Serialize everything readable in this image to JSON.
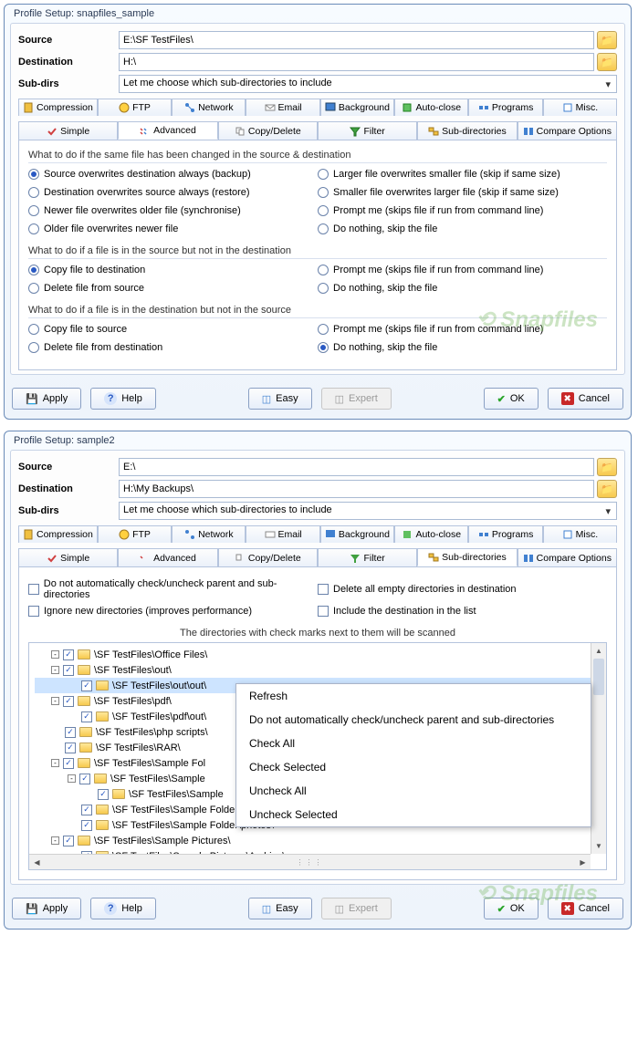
{
  "win1": {
    "title": "Profile Setup: snapfiles_sample",
    "labels": {
      "source": "Source",
      "destination": "Destination",
      "subdirs": "Sub-dirs"
    },
    "source": "E:\\SF TestFiles\\",
    "destination": "H:\\",
    "subdirs_opt": "Let me choose which sub-directories to include",
    "tabs1": [
      "Compression",
      "FTP",
      "Network",
      "Email",
      "Background",
      "Auto-close",
      "Programs",
      "Misc."
    ],
    "tabs2": [
      "Simple",
      "Advanced",
      "Copy/Delete",
      "Filter",
      "Sub-directories",
      "Compare Options"
    ],
    "sec1": "What to do if the same file has been changed in the source & destination",
    "sec1_left": [
      {
        "label": "Source overwrites destination always (backup)",
        "sel": true
      },
      {
        "label": "Destination overwrites source always (restore)",
        "sel": false
      },
      {
        "label": "Newer file overwrites older file (synchronise)",
        "sel": false
      },
      {
        "label": "Older file overwrites newer file",
        "sel": false
      }
    ],
    "sec1_right": [
      {
        "label": "Larger file overwrites smaller file (skip if same size)",
        "sel": false
      },
      {
        "label": "Smaller file overwrites larger file (skip if same size)",
        "sel": false
      },
      {
        "label": "Prompt me (skips file if run from command line)",
        "sel": false
      },
      {
        "label": "Do nothing, skip the file",
        "sel": false
      }
    ],
    "sec2": "What to do if a file is in the source but not in the destination",
    "sec2_left": [
      {
        "label": "Copy file to destination",
        "sel": true
      },
      {
        "label": "Delete file from source",
        "sel": false
      }
    ],
    "sec2_right": [
      {
        "label": "Prompt me  (skips file if run from command line)",
        "sel": false
      },
      {
        "label": "Do nothing, skip the file",
        "sel": false
      }
    ],
    "sec3": "What to do if a file is in the destination but not in the source",
    "sec3_left": [
      {
        "label": "Copy file to source",
        "sel": false
      },
      {
        "label": "Delete file from destination",
        "sel": false
      }
    ],
    "sec3_right": [
      {
        "label": "Prompt me  (skips file if run from command line)",
        "sel": false
      },
      {
        "label": "Do nothing, skip the file",
        "sel": true
      }
    ]
  },
  "win2": {
    "title": "Profile Setup: sample2",
    "source": "E:\\",
    "destination": "H:\\My Backups\\",
    "subdirs_opt": "Let me choose which sub-directories to include",
    "checks": [
      {
        "label": "Do not automatically check/uncheck parent and sub-directories",
        "checked": false
      },
      {
        "label": "Delete all empty directories in destination",
        "checked": false
      },
      {
        "label": "Ignore new directories (improves performance)",
        "checked": false
      },
      {
        "label": "Include the destination in the list",
        "checked": false
      }
    ],
    "scan_info": "The directories with check marks next to them will be scanned",
    "tree": [
      {
        "indent": 0,
        "toggle": "-",
        "checked": true,
        "label": "\\SF TestFiles\\Office Files\\"
      },
      {
        "indent": 0,
        "toggle": "-",
        "checked": true,
        "label": "\\SF TestFiles\\out\\"
      },
      {
        "indent": 1,
        "toggle": "",
        "checked": true,
        "label": "\\SF TestFiles\\out\\out\\",
        "sel": true
      },
      {
        "indent": 0,
        "toggle": "-",
        "checked": true,
        "label": "\\SF TestFiles\\pdf\\"
      },
      {
        "indent": 1,
        "toggle": "",
        "checked": true,
        "label": "\\SF TestFiles\\pdf\\out\\"
      },
      {
        "indent": 0,
        "toggle": "",
        "checked": true,
        "label": "\\SF TestFiles\\php scripts\\"
      },
      {
        "indent": 0,
        "toggle": "",
        "checked": true,
        "label": "\\SF TestFiles\\RAR\\"
      },
      {
        "indent": 0,
        "toggle": "-",
        "checked": true,
        "label": "\\SF TestFiles\\Sample Fol"
      },
      {
        "indent": 1,
        "toggle": "-",
        "checked": true,
        "label": "\\SF TestFiles\\Sample"
      },
      {
        "indent": 2,
        "toggle": "",
        "checked": true,
        "label": "\\SF TestFiles\\Sample"
      },
      {
        "indent": 1,
        "toggle": "",
        "checked": true,
        "label": "\\SF TestFiles\\Sample Folder\\"
      },
      {
        "indent": 1,
        "toggle": "",
        "checked": true,
        "label": "\\SF TestFiles\\Sample Folder\\photos\\"
      },
      {
        "indent": 0,
        "toggle": "-",
        "checked": true,
        "label": "\\SF TestFiles\\Sample Pictures\\"
      },
      {
        "indent": 1,
        "toggle": "",
        "checked": true,
        "label": "\\SF TestFiles\\Sample Pictures\\Archive\\"
      }
    ],
    "context_menu": [
      "Refresh",
      "Do not automatically check/uncheck parent and sub-directories",
      "Check All",
      "Check Selected",
      "Uncheck All",
      "Uncheck Selected"
    ]
  },
  "buttons": {
    "apply": "Apply",
    "help": "Help",
    "easy": "Easy",
    "expert": "Expert",
    "ok": "OK",
    "cancel": "Cancel"
  },
  "watermark": "Snapfiles"
}
